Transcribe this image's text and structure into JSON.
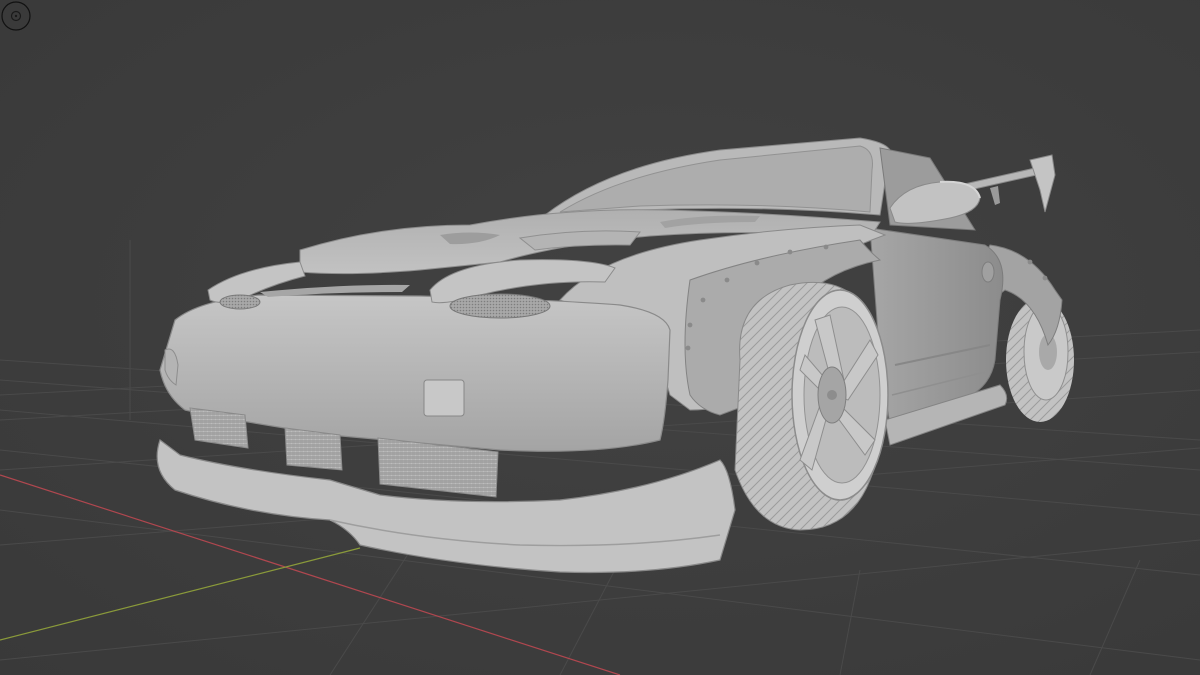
{
  "viewport": {
    "shading_mode": "solid",
    "background_color": "#3d3d3d",
    "grid_color": "#4b4b4b",
    "x_axis_color": "#b0474f",
    "y_axis_color": "#8a9a3a",
    "model_color": "#b8b8b8"
  },
  "scene": {
    "object": "car-model",
    "empty_icon": "empty-object-icon"
  }
}
